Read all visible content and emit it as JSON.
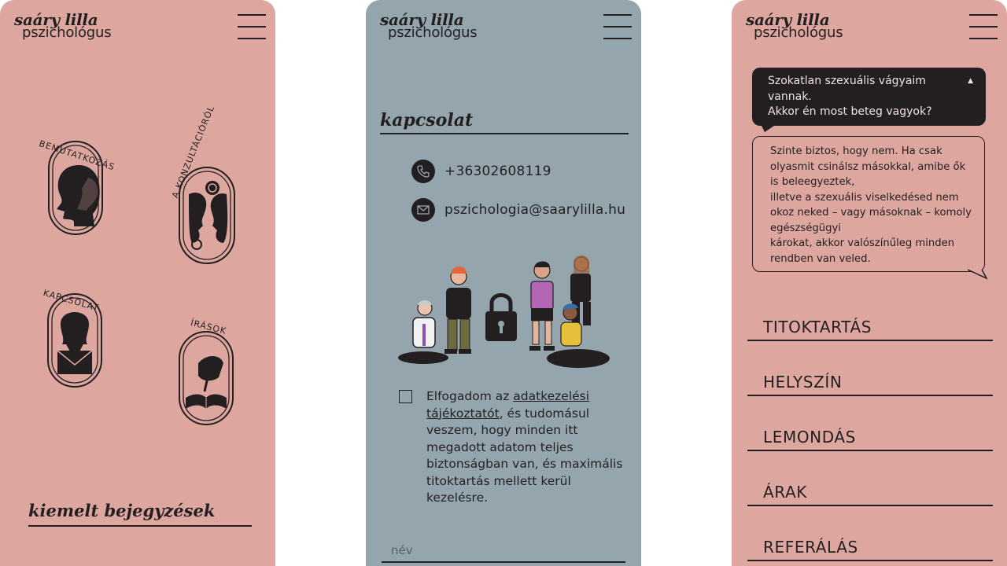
{
  "colors": {
    "pink": "#dda7a0",
    "slate": "#94a5ae",
    "ink": "#231f20",
    "cream": "#f2e3e0"
  },
  "brand": {
    "line1": "saáry lilla",
    "line2": "pszichológus"
  },
  "menu_icon": "hamburger-menu-icon",
  "panel1": {
    "cards": [
      {
        "label": "BEMUTATKOZÁS",
        "icon": "silhouette-profile-icon"
      },
      {
        "label": "A KONZULTÁCIÓRÓL",
        "icon": "two-faces-icon"
      },
      {
        "label": "KAPCSOLAT",
        "icon": "envelope-head-icon"
      },
      {
        "label": "ÍRÁSOK",
        "icon": "hand-writing-book-icon"
      }
    ],
    "featured_heading": "kiemelt bejegyzések"
  },
  "panel2": {
    "heading": "kapcsolat",
    "phone": "+36302608119",
    "email": "pszichologia@saarylilla.hu",
    "illustration": "people-with-padlock-illustration",
    "consent": {
      "before": "Elfogadom az ",
      "link": "adatkezelési tájékoztatót",
      "after": ", és tudomásul veszem, hogy minden itt megadott adatom teljes biztonságban van, és maximális titoktartás mellett kerül kezelésre."
    },
    "name_placeholder": "név"
  },
  "panel3": {
    "question_line1": "Szokatlan szexuális vágyaim vannak.",
    "question_line2": "Akkor én most beteg vagyok?",
    "answer_lines": [
      "Szinte biztos, hogy nem. Ha csak olyasmit csinálsz másokkal, amibe ők is beleegyeztek,",
      "illetve a szexuális viselkedésed nem okoz neked – vagy másoknak – komoly egészségügyi",
      "károkat, akkor valószínűleg minden rendben van veled."
    ],
    "accordion": [
      "TITOKTARTÁS",
      "HELYSZÍN",
      "LEMONDÁS",
      "ÁRAK",
      "REFERÁLÁS"
    ]
  }
}
